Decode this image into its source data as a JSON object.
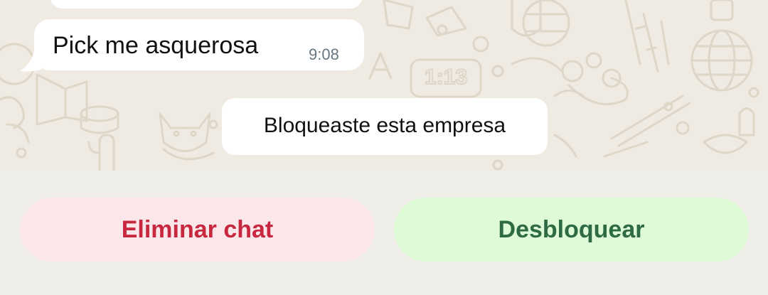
{
  "colors": {
    "chat_background": "#efeae2",
    "bubble": "#ffffff",
    "footer_background": "#f0eee8",
    "delete_bg": "#fbe7ea",
    "delete_text": "#c8283f",
    "unblock_bg": "#dffad6",
    "unblock_text": "#2e6b45"
  },
  "messages": [
    {
      "text": "Pick me asquerosa",
      "time": "9:08"
    }
  ],
  "system_message": "Bloqueaste esta empresa",
  "wallpaper_clock": "1:13",
  "actions": {
    "delete_label": "Eliminar chat",
    "unblock_label": "Desbloquear"
  }
}
